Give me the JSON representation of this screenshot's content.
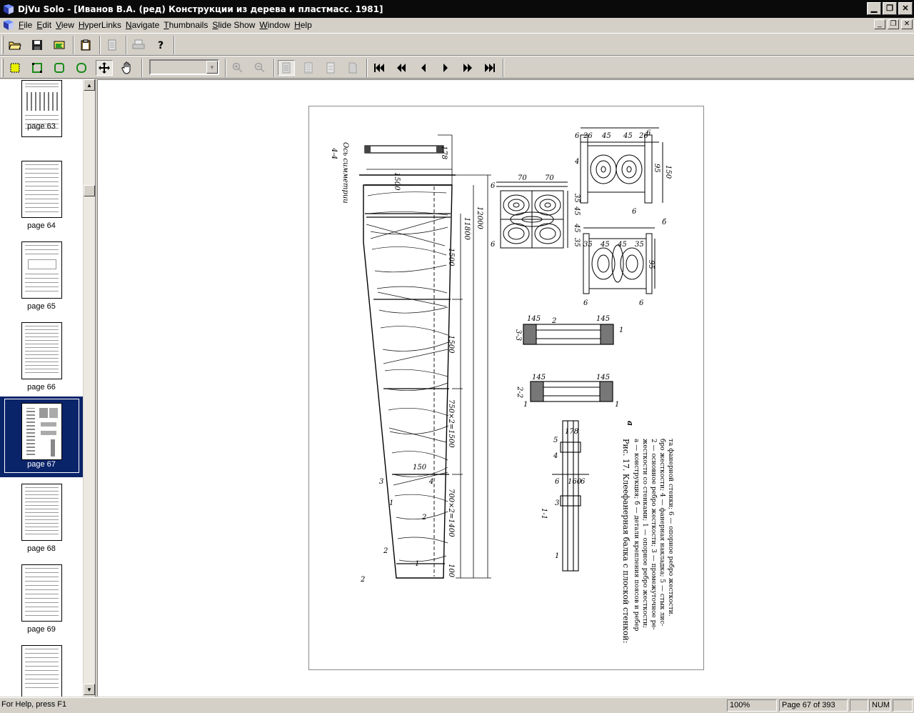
{
  "window": {
    "title": "DjVu Solo - [Иванов В.А. (ред) Конструкции из дерева и пластмасс. 1981]"
  },
  "menu": {
    "items": [
      {
        "label": "File",
        "accel": "F",
        "rest": "ile"
      },
      {
        "label": "Edit",
        "accel": "E",
        "rest": "dit"
      },
      {
        "label": "View",
        "accel": "V",
        "rest": "iew"
      },
      {
        "label": "HyperLinks",
        "accel": "H",
        "rest": "yperLinks"
      },
      {
        "label": "Navigate",
        "accel": "N",
        "rest": "avigate"
      },
      {
        "label": "Thumbnails",
        "accel": "T",
        "rest": "humbnails"
      },
      {
        "label": "Slide Show",
        "accel": "S",
        "rest": "lide Show"
      },
      {
        "label": "Window",
        "accel": "W",
        "rest": "indow"
      },
      {
        "label": "Help",
        "accel": "H",
        "rest": "elp"
      }
    ]
  },
  "toolbar": {
    "zoom_select_value": ""
  },
  "thumbnails": [
    {
      "label": "page 63",
      "selected": false
    },
    {
      "label": "page 64",
      "selected": false
    },
    {
      "label": "page 65",
      "selected": false
    },
    {
      "label": "page 66",
      "selected": false
    },
    {
      "label": "page 67",
      "selected": true
    },
    {
      "label": "page 68",
      "selected": false
    },
    {
      "label": "page 69",
      "selected": false
    },
    {
      "label": "",
      "selected": false
    }
  ],
  "document": {
    "figure_caption_lines": [
      "Рис. 17. Клеефанерная балка с плоской стенкой:",
      "а — конструкция; б — детали крепления поясов и ребер",
      "жесткости со стенками; 1 — опорное ребро жесткости;",
      "2 — основное ребро жесткости; 3 — промежуточное ре-",
      "бро жесткости; 4 — фанерная накладка; 5 — стык лис-",
      "та фанерной стенки; 6 — опорное ребро жесткости."
    ],
    "dimension_labels": [
      "1500",
      "11800",
      "12000",
      "1500",
      "1500",
      "750×2=1500",
      "700×2=1400",
      "100",
      "150",
      "70",
      "70",
      "45",
      "45",
      "35",
      "35",
      "95",
      "150",
      "95",
      "26",
      "45",
      "26",
      "35",
      "45",
      "35",
      "145",
      "145",
      "145",
      "145",
      "178",
      "160",
      "178"
    ],
    "section_labels": [
      "4-4",
      "Ось симметрии",
      "3-3",
      "2-2",
      "1-1",
      "а",
      "б"
    ]
  },
  "status": {
    "help_text": "For Help, press F1",
    "zoom": "100%",
    "page_info": "Page 67 of 393",
    "num": "NUM"
  }
}
